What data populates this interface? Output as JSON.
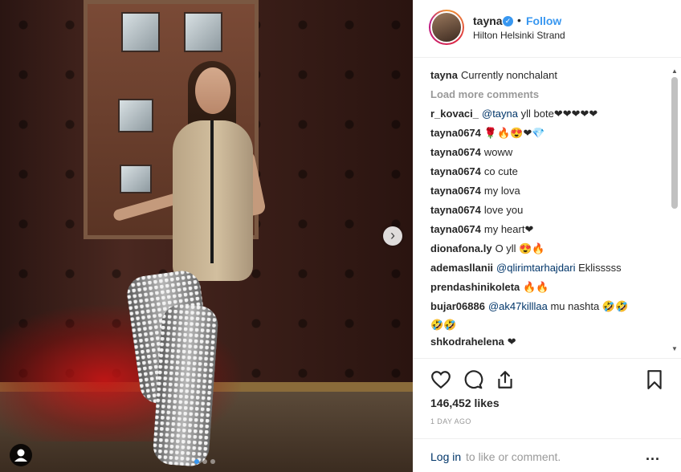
{
  "header": {
    "username": "tayna",
    "separator": "•",
    "follow_label": "Follow",
    "location": "Hilton Helsinki Strand"
  },
  "caption": {
    "user": "tayna",
    "text": "Currently nonchalant"
  },
  "load_more_label": "Load more comments",
  "comments": [
    {
      "user": "r_kovaci_",
      "mention": "@tayna",
      "text": "yll bote❤❤❤❤❤"
    },
    {
      "user": "tayna0674",
      "mention": "",
      "text": "🌹🔥😍❤💎"
    },
    {
      "user": "tayna0674",
      "mention": "",
      "text": "woww"
    },
    {
      "user": "tayna0674",
      "mention": "",
      "text": "co cute"
    },
    {
      "user": "tayna0674",
      "mention": "",
      "text": "my lova"
    },
    {
      "user": "tayna0674",
      "mention": "",
      "text": "love you"
    },
    {
      "user": "tayna0674",
      "mention": "",
      "text": "my heart❤"
    },
    {
      "user": "dionafona.ly",
      "mention": "",
      "text": "O yll 😍🔥"
    },
    {
      "user": "ademasllanii",
      "mention": "@qlirimtarhajdari",
      "text": "Eklisssss"
    },
    {
      "user": "prendashinikoleta",
      "mention": "",
      "text": "🔥🔥"
    },
    {
      "user": "bujar06886",
      "mention": "@ak47killlaa",
      "text": "mu nashta 🤣🤣",
      "continuation": "🤣🤣"
    },
    {
      "user": "shkodrahelena",
      "mention": "",
      "text": "❤"
    }
  ],
  "stats": {
    "likes": "146,452 likes",
    "age": "1 DAY AGO"
  },
  "footer": {
    "login_link": "Log in",
    "login_rest": "to like or comment.",
    "more_label": "..."
  },
  "photo": {
    "carousel_dots": 3,
    "active_dot": 0,
    "next_arrow": "›"
  },
  "icons": {
    "verified": "verified-badge-icon",
    "like": "heart-icon",
    "comment": "comment-bubble-icon",
    "share": "share-icon",
    "save": "bookmark-icon",
    "tag": "user-tag-icon"
  },
  "colors": {
    "accent": "#3897f0",
    "link": "#003569",
    "muted": "#999999",
    "text": "#262626"
  }
}
